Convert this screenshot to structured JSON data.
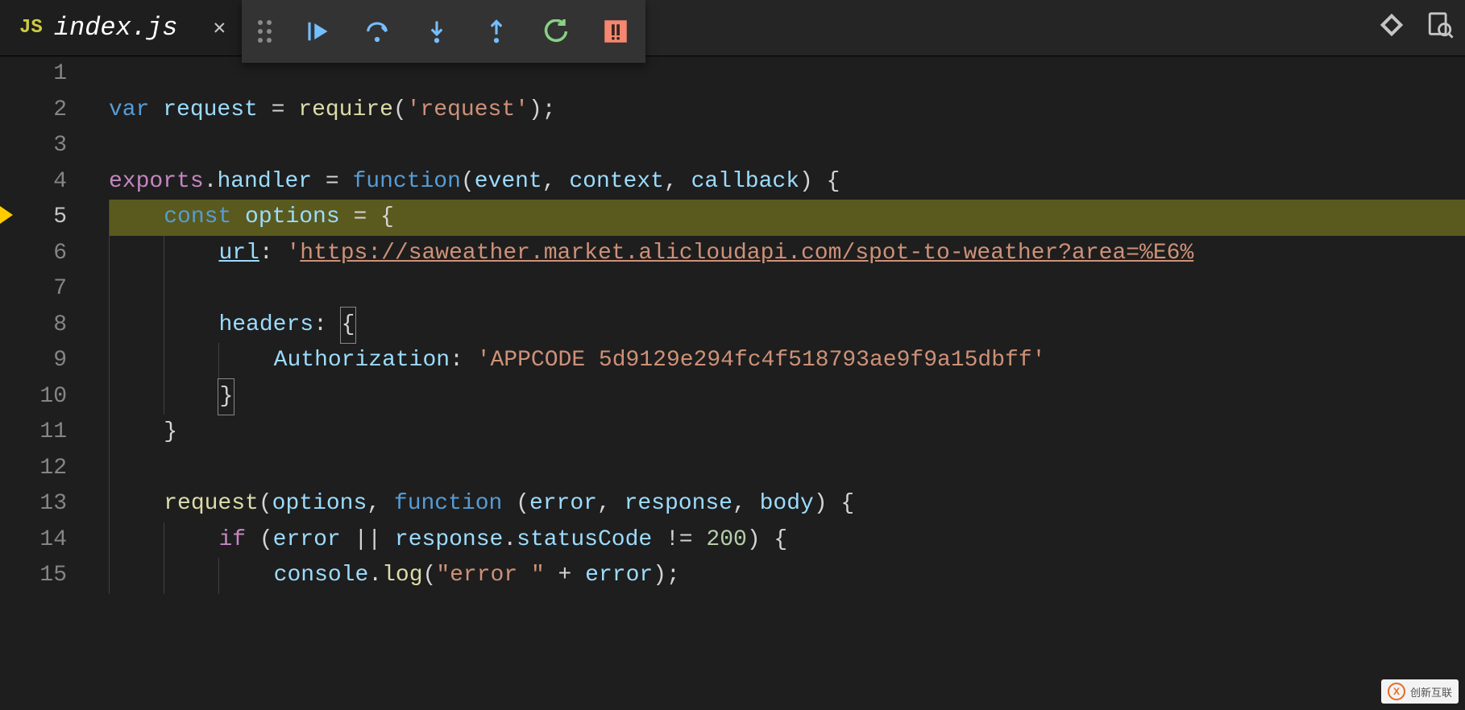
{
  "tab": {
    "language_badge": "JS",
    "filename": "index.js"
  },
  "debug_toolbar": {
    "buttons": [
      "continue",
      "step-over",
      "step-into",
      "step-out",
      "restart",
      "stop"
    ]
  },
  "editor": {
    "active_line": 5,
    "breakpoint_line": 5,
    "lines": [
      {
        "n": 1,
        "tokens": []
      },
      {
        "n": 2,
        "tokens": [
          {
            "t": "var ",
            "c": "kw"
          },
          {
            "t": "request",
            "c": "id"
          },
          {
            "t": " = ",
            "c": "op"
          },
          {
            "t": "require",
            "c": "fn"
          },
          {
            "t": "(",
            "c": "punc"
          },
          {
            "t": "'request'",
            "c": "str"
          },
          {
            "t": ")",
            "c": "punc"
          },
          {
            "t": ";",
            "c": "punc"
          }
        ]
      },
      {
        "n": 3,
        "tokens": []
      },
      {
        "n": 4,
        "tokens": [
          {
            "t": "exports",
            "c": "kw2"
          },
          {
            "t": ".",
            "c": "punc"
          },
          {
            "t": "handler",
            "c": "id"
          },
          {
            "t": " = ",
            "c": "op"
          },
          {
            "t": "function",
            "c": "kw"
          },
          {
            "t": "(",
            "c": "punc"
          },
          {
            "t": "event",
            "c": "id"
          },
          {
            "t": ", ",
            "c": "punc"
          },
          {
            "t": "context",
            "c": "id"
          },
          {
            "t": ", ",
            "c": "punc"
          },
          {
            "t": "callback",
            "c": "id"
          },
          {
            "t": ") {",
            "c": "punc"
          }
        ]
      },
      {
        "n": 5,
        "hl": true,
        "indent": 1,
        "tokens": [
          {
            "t": "const ",
            "c": "kw"
          },
          {
            "t": "options",
            "c": "id"
          },
          {
            "t": " = {",
            "c": "punc"
          }
        ]
      },
      {
        "n": 6,
        "indent": 2,
        "tokens": [
          {
            "t": "url",
            "c": "url"
          },
          {
            "t": ": ",
            "c": "punc"
          },
          {
            "t": "'",
            "c": "str"
          },
          {
            "t": "https://saweather.market.alicloudapi.com/spot-to-weather?area=%E6%",
            "c": "str-u"
          }
        ]
      },
      {
        "n": 7,
        "indent": 2,
        "tokens": []
      },
      {
        "n": 8,
        "indent": 2,
        "tokens": [
          {
            "t": "headers",
            "c": "id"
          },
          {
            "t": ": ",
            "c": "punc"
          },
          {
            "t": "{",
            "c": "punc",
            "box": true
          }
        ]
      },
      {
        "n": 9,
        "indent": 3,
        "tokens": [
          {
            "t": "Authorization",
            "c": "id"
          },
          {
            "t": ": ",
            "c": "punc"
          },
          {
            "t": "'APPCODE 5d9129e294fc4f518793ae9f9a15dbff'",
            "c": "str"
          }
        ]
      },
      {
        "n": 10,
        "indent": 2,
        "tokens": [
          {
            "t": "}",
            "c": "punc",
            "box": true
          }
        ]
      },
      {
        "n": 11,
        "indent": 1,
        "tokens": [
          {
            "t": "}",
            "c": "punc"
          }
        ]
      },
      {
        "n": 12,
        "indent": 1,
        "tokens": []
      },
      {
        "n": 13,
        "indent": 1,
        "tokens": [
          {
            "t": "request",
            "c": "fn"
          },
          {
            "t": "(",
            "c": "punc"
          },
          {
            "t": "options",
            "c": "id"
          },
          {
            "t": ", ",
            "c": "punc"
          },
          {
            "t": "function ",
            "c": "kw"
          },
          {
            "t": "(",
            "c": "punc"
          },
          {
            "t": "error",
            "c": "id"
          },
          {
            "t": ", ",
            "c": "punc"
          },
          {
            "t": "response",
            "c": "id"
          },
          {
            "t": ", ",
            "c": "punc"
          },
          {
            "t": "body",
            "c": "id"
          },
          {
            "t": ") {",
            "c": "punc"
          }
        ]
      },
      {
        "n": 14,
        "indent": 2,
        "tokens": [
          {
            "t": "if ",
            "c": "kw2"
          },
          {
            "t": "(",
            "c": "punc"
          },
          {
            "t": "error",
            "c": "id"
          },
          {
            "t": " || ",
            "c": "op"
          },
          {
            "t": "response",
            "c": "id"
          },
          {
            "t": ".",
            "c": "punc"
          },
          {
            "t": "statusCode",
            "c": "id"
          },
          {
            "t": " != ",
            "c": "op"
          },
          {
            "t": "200",
            "c": "num"
          },
          {
            "t": ") {",
            "c": "punc"
          }
        ]
      },
      {
        "n": 15,
        "indent": 3,
        "tokens": [
          {
            "t": "console",
            "c": "id"
          },
          {
            "t": ".",
            "c": "punc"
          },
          {
            "t": "log",
            "c": "fn"
          },
          {
            "t": "(",
            "c": "punc"
          },
          {
            "t": "\"error \"",
            "c": "str"
          },
          {
            "t": " + ",
            "c": "op"
          },
          {
            "t": "error",
            "c": "id"
          },
          {
            "t": ");",
            "c": "punc"
          }
        ]
      }
    ]
  },
  "watermark": {
    "brand": "创新互联"
  }
}
